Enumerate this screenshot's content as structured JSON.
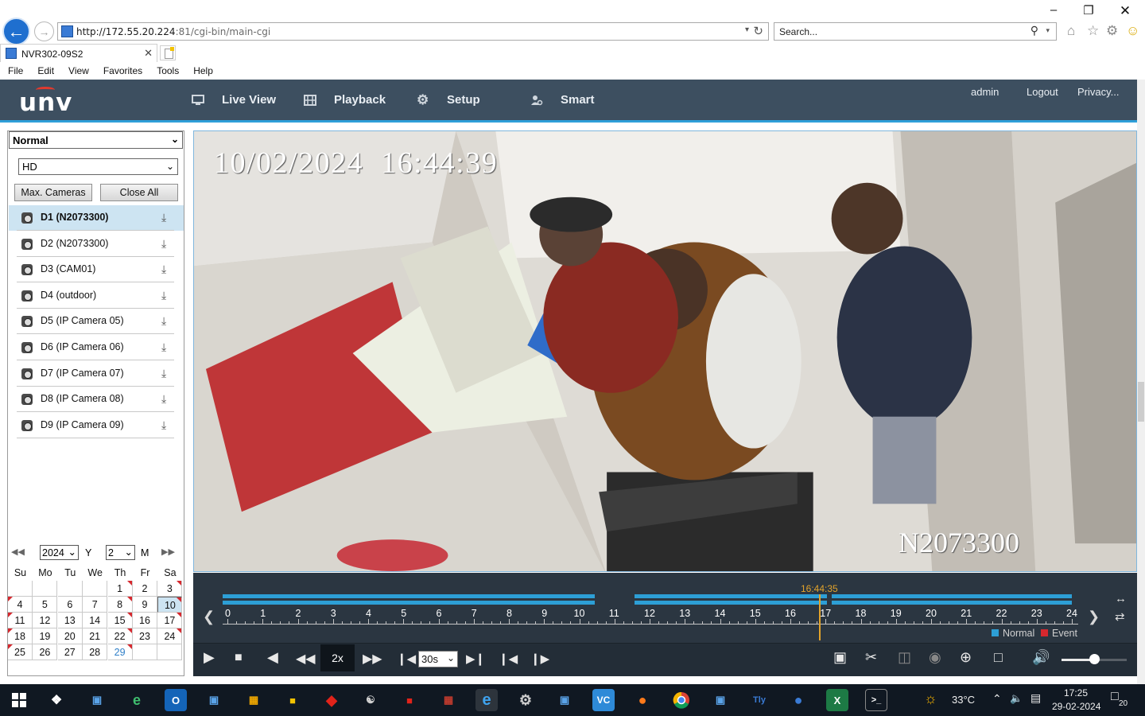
{
  "browser": {
    "url_host": "http://172.55.20.224",
    "url_path": ":81/cgi-bin/main-cgi",
    "search_placeholder": "Search...",
    "tab_title": "NVR302-09S2",
    "menu": [
      "File",
      "Edit",
      "View",
      "Favorites",
      "Tools",
      "Help"
    ]
  },
  "header": {
    "logo": "unv",
    "nav": [
      "Live View",
      "Playback",
      "Setup",
      "Smart"
    ],
    "active_nav": "Playback",
    "user": "admin",
    "logout": "Logout",
    "privacy": "Privacy..."
  },
  "left": {
    "mode": "Normal",
    "stream": "HD",
    "max_cameras": "Max. Cameras",
    "close_all": "Close All",
    "cameras": [
      "D1 (N2073300)",
      "D2 (N2073300)",
      "D3 (CAM01)",
      "D4 (outdoor)",
      "D5 (IP Camera 05)",
      "D6 (IP Camera 06)",
      "D7 (IP Camera 07)",
      "D8 (IP Camera 08)",
      "D9 (IP Camera 09)"
    ],
    "active_camera_index": 0
  },
  "calendar": {
    "year": "2024",
    "year_unit": "Y",
    "month": "2",
    "month_unit": "M",
    "weekdays": [
      "Su",
      "Mo",
      "Tu",
      "We",
      "Th",
      "Fr",
      "Sa"
    ],
    "selected_day": "10",
    "today": "29"
  },
  "video": {
    "osd_time": "10/02/2024  16:44:39",
    "osd_camera": "N2073300"
  },
  "timeline": {
    "cursor_time": "16:44:35",
    "hours": [
      "0",
      "1",
      "2",
      "3",
      "4",
      "5",
      "6",
      "7",
      "8",
      "9",
      "10",
      "11",
      "12",
      "13",
      "14",
      "15",
      "16",
      "17",
      "18",
      "19",
      "20",
      "21",
      "22",
      "23",
      "24"
    ],
    "recorded_segments_hours": [
      [
        0,
        10.45
      ],
      [
        11.7,
        17.05
      ],
      [
        17.3,
        24
      ]
    ],
    "legend_normal": "Normal",
    "legend_event": "Event",
    "colors": {
      "normal": "#2d9fd6",
      "event": "#d6282e",
      "cursor": "#e2a32b"
    }
  },
  "controls": {
    "speed": "2x",
    "interval": "30s",
    "volume_fraction": 0.5
  },
  "taskbar": {
    "weather": "33°C",
    "time": "17:25",
    "date": "29-02-2024",
    "notifications": "20"
  }
}
